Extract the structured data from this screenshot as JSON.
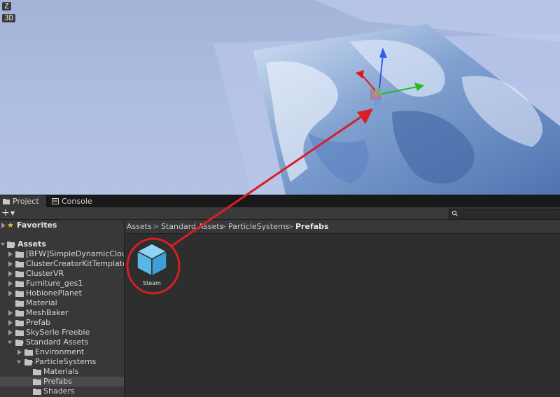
{
  "scene": {
    "axis_label": "Z",
    "view_mode": "3D"
  },
  "tabs": [
    {
      "label": "Project",
      "icon": "folder-icon"
    },
    {
      "label": "Console",
      "icon": "console-icon"
    }
  ],
  "toolbar": {
    "create_label": "+",
    "search_placeholder": ""
  },
  "tree": {
    "favorites": "Favorites",
    "assets": "Assets",
    "items": [
      "[BFW]SimpleDynamicClouds",
      "ClusterCreatorKitTemplate",
      "ClusterVR",
      "Furniture_ges1",
      "HobionePlanet",
      "Material",
      "MeshBaker",
      "Prefab",
      "SkySerie Freebie",
      "Standard Assets",
      "Environment",
      "ParticleSystems",
      "Materials",
      "Prefabs",
      "Shaders"
    ]
  },
  "breadcrumb": [
    "Assets",
    "Standard Assets",
    "ParticleSystems",
    "Prefabs"
  ],
  "asset": {
    "label": "Steam",
    "icon": "prefab-cube-icon"
  },
  "colors": {
    "annotation": "#d81f26",
    "prefab": "#56b7e8",
    "selection": "#4a4a4a"
  }
}
